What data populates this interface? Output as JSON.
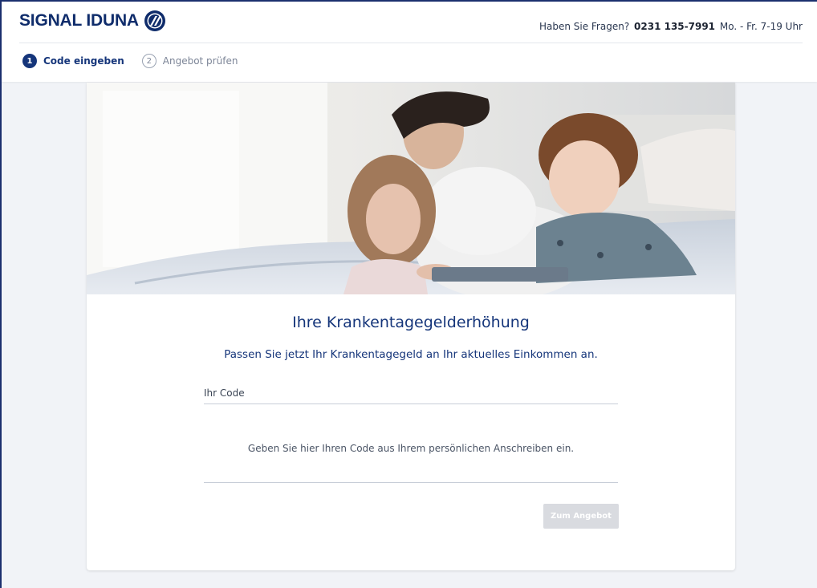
{
  "header": {
    "brand_name": "SIGNAL IDUNA",
    "contact_prefix": "Haben Sie Fragen?",
    "phone": "0231 135-7991",
    "hours": "Mo. - Fr. 7-19 Uhr"
  },
  "steps": [
    {
      "number": "1",
      "label": "Code eingeben",
      "active": true
    },
    {
      "number": "2",
      "label": "Angebot prüfen",
      "active": false
    }
  ],
  "main": {
    "title": "Ihre Krankentagegelderhöhung",
    "subtitle": "Passen Sie jetzt Ihr Krankentagegeld an Ihr aktuelles Einkommen an.",
    "code_label": "Ihr Code",
    "code_value": "",
    "hint": "Geben Sie hier Ihren Code aus Ihrem persönlichen Anschreiben ein.",
    "submit_label": "Zum Angebot"
  },
  "colors": {
    "brand": "#0f2c6b",
    "accent": "#15357a",
    "page_bg": "#f1f3f7",
    "button_disabled": "#d9dbe0"
  },
  "icons": {
    "brand_logo": "signal-iduna-logo-icon"
  }
}
